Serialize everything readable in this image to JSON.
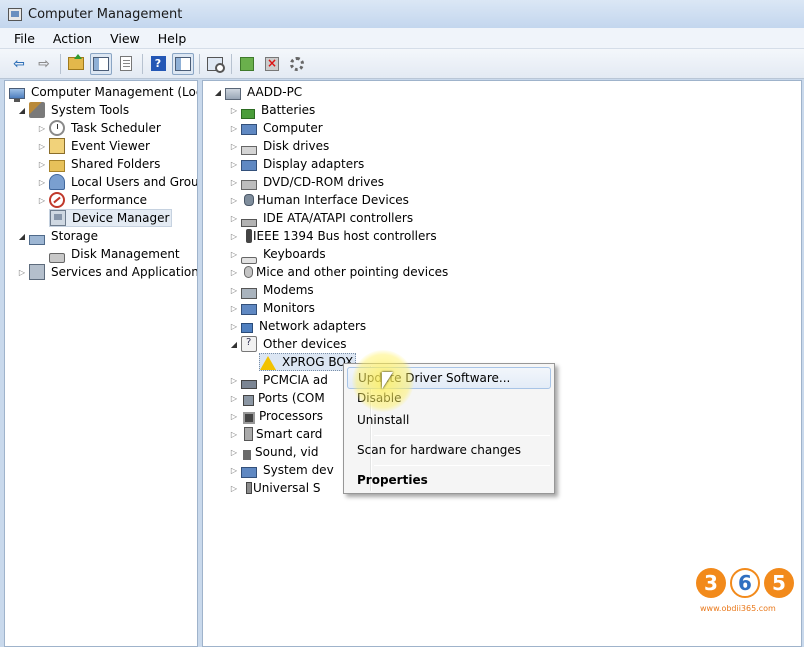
{
  "window": {
    "title": "Computer Management"
  },
  "menubar": {
    "items": [
      "File",
      "Action",
      "View",
      "Help"
    ]
  },
  "left_tree": {
    "root": "Computer Management (Local",
    "system_tools": "System Tools",
    "task_scheduler": "Task Scheduler",
    "event_viewer": "Event Viewer",
    "shared_folders": "Shared Folders",
    "local_users": "Local Users and Groups",
    "performance": "Performance",
    "device_manager": "Device Manager",
    "storage": "Storage",
    "disk_management": "Disk Management",
    "services": "Services and Applications"
  },
  "device_tree": {
    "root": "AADD-PC",
    "categories": [
      "Batteries",
      "Computer",
      "Disk drives",
      "Display adapters",
      "DVD/CD-ROM drives",
      "Human Interface Devices",
      "IDE ATA/ATAPI controllers",
      "IEEE 1394 Bus host controllers",
      "Keyboards",
      "Mice and other pointing devices",
      "Modems",
      "Monitors",
      "Network adapters",
      "Other devices"
    ],
    "selected_device": "XPROG BOX",
    "categories_after": [
      "PCMCIA ad",
      "Ports (COM",
      "Processors",
      "Smart card",
      "Sound, vid",
      "System dev",
      "Universal S"
    ]
  },
  "context_menu": {
    "update": "Update Driver Software...",
    "disable": "Disable",
    "uninstall": "Uninstall",
    "scan": "Scan for hardware changes",
    "properties": "Properties"
  },
  "watermark": {
    "digits": [
      "3",
      "6",
      "5"
    ],
    "site": "www.obdii365.com"
  },
  "colors": {
    "accent": "#2f6fc1",
    "selection": "#dce6f3",
    "watermark_orange": "#f28a1b"
  }
}
